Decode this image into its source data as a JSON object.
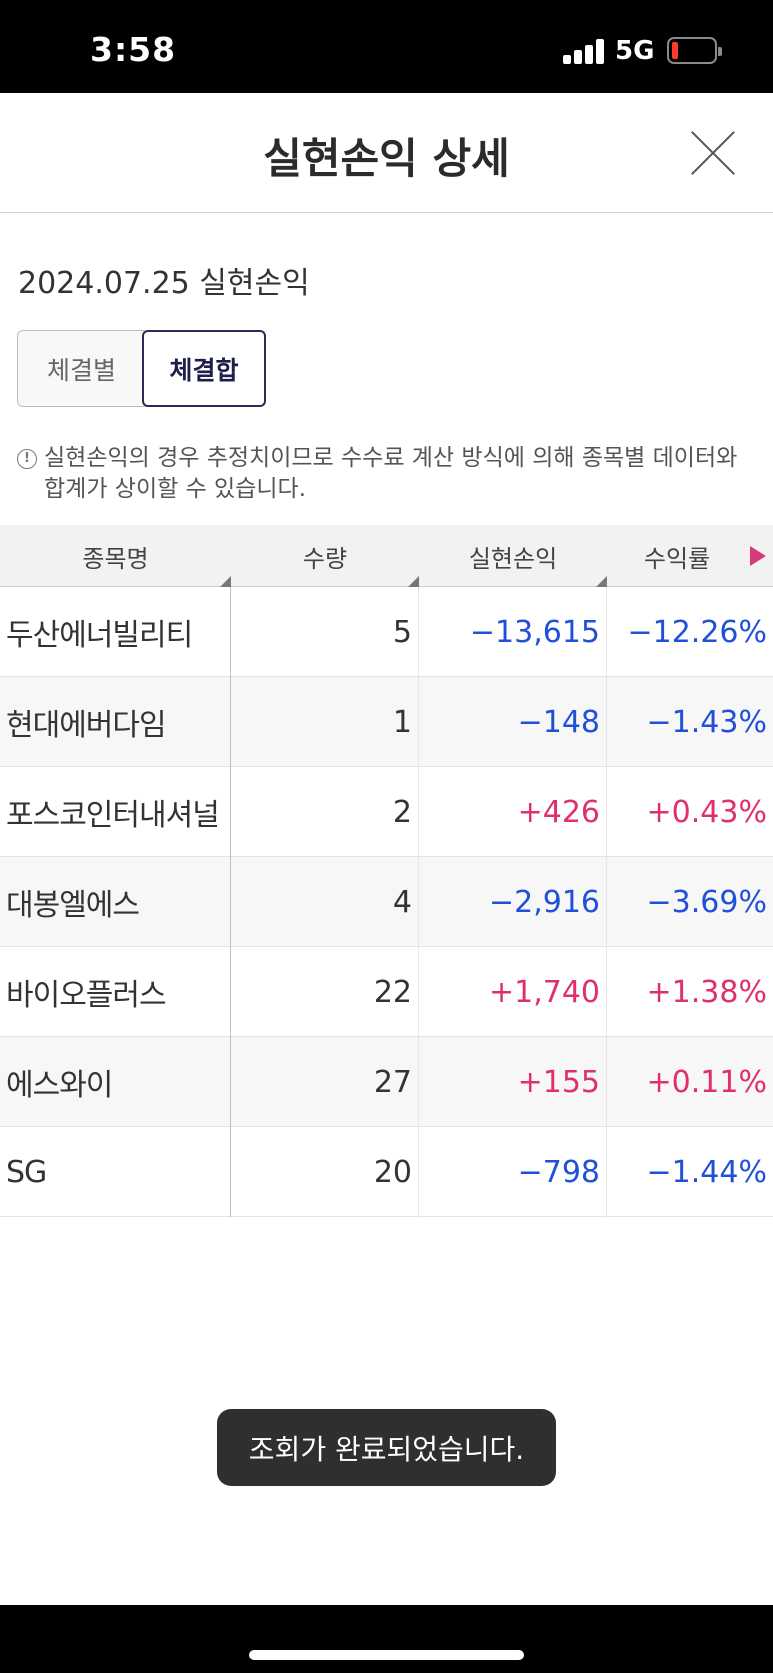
{
  "status_bar": {
    "time": "3:58",
    "network": "5G"
  },
  "header": {
    "title": "실현손익 상세"
  },
  "date_title": "2024.07.25 실현손익",
  "segment": {
    "left_label": "체결별",
    "right_label": "체결합",
    "selected": "체결합"
  },
  "notice": {
    "icon_char": "!",
    "text": "실현손익의 경우 추정치이므로 수수료 계산 방식에 의해 종목별 데이터와 합계가 상이할 수 있습니다."
  },
  "table": {
    "columns": [
      "종목명",
      "수량",
      "실현손익",
      "수익률"
    ],
    "rows": [
      {
        "name": "두산에너빌리티",
        "qty": "5",
        "pl": "−13,615",
        "rate": "−12.26%",
        "dir": "neg"
      },
      {
        "name": "현대에버다임",
        "qty": "1",
        "pl": "−148",
        "rate": "−1.43%",
        "dir": "neg"
      },
      {
        "name": "포스코인터내셔널",
        "qty": "2",
        "pl": "+426",
        "rate": "+0.43%",
        "dir": "pos"
      },
      {
        "name": "대봉엘에스",
        "qty": "4",
        "pl": "−2,916",
        "rate": "−3.69%",
        "dir": "neg"
      },
      {
        "name": "바이오플러스",
        "qty": "22",
        "pl": "+1,740",
        "rate": "+1.38%",
        "dir": "pos"
      },
      {
        "name": "에스와이",
        "qty": "27",
        "pl": "+155",
        "rate": "+0.11%",
        "dir": "pos"
      },
      {
        "name": "SG",
        "qty": "20",
        "pl": "−798",
        "rate": "−1.44%",
        "dir": "neg"
      }
    ]
  },
  "toast": {
    "message": "조회가 완료되었습니다."
  },
  "colors": {
    "negative": "#2150d8",
    "positive": "#e0306b",
    "accent_arrow": "#d63a7d"
  }
}
